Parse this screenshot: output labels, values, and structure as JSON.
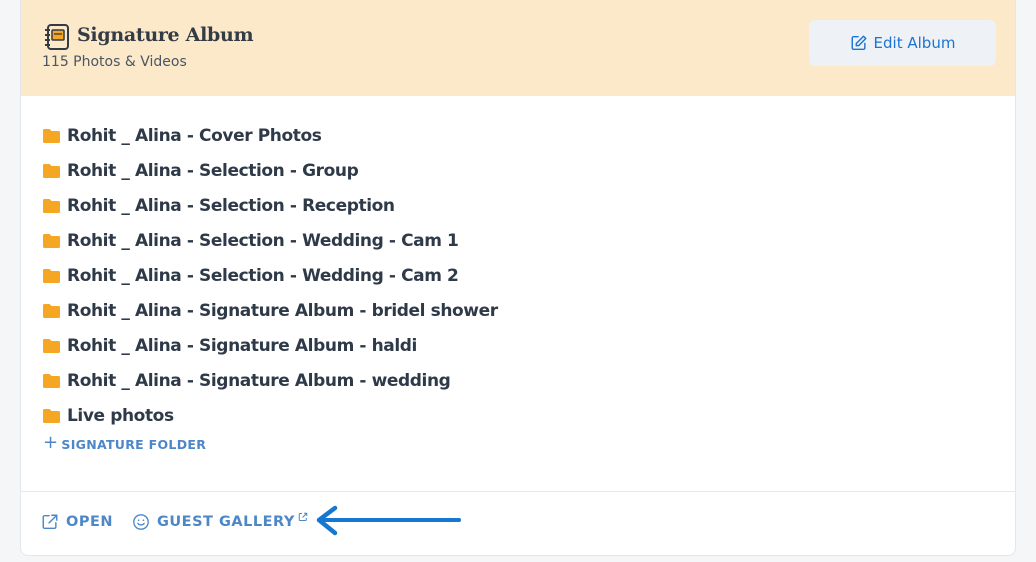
{
  "album": {
    "title": "Signature Album",
    "count_text": "115 Photos & Videos",
    "edit_label": "Edit Album"
  },
  "folders": [
    "Rohit _ Alina - Cover Photos",
    "Rohit _ Alina - Selection - Group",
    "Rohit _ Alina - Selection - Reception",
    "Rohit _ Alina - Selection - Wedding - Cam 1",
    "Rohit _ Alina - Selection - Wedding - Cam 2",
    "Rohit _ Alina - Signature Album - bridel shower",
    "Rohit _ Alina - Signature Album - haldi",
    "Rohit _ Alina - Signature Album - wedding",
    "Live photos"
  ],
  "add_folder_label": "SIGNATURE FOLDER",
  "footer": {
    "open_label": "OPEN",
    "guest_gallery_label": "GUEST GALLERY"
  },
  "colors": {
    "header_bg": "#fbe9ca",
    "folder": "#f5a623",
    "accent": "#1b74d4",
    "link": "#4d87c8",
    "arrow": "#1677d0"
  },
  "icons": {
    "album": "album-book-icon",
    "edit": "edit-icon",
    "folder": "folder-icon",
    "add": "plus-icon",
    "open": "external-link-icon",
    "guest": "smiley-icon"
  }
}
